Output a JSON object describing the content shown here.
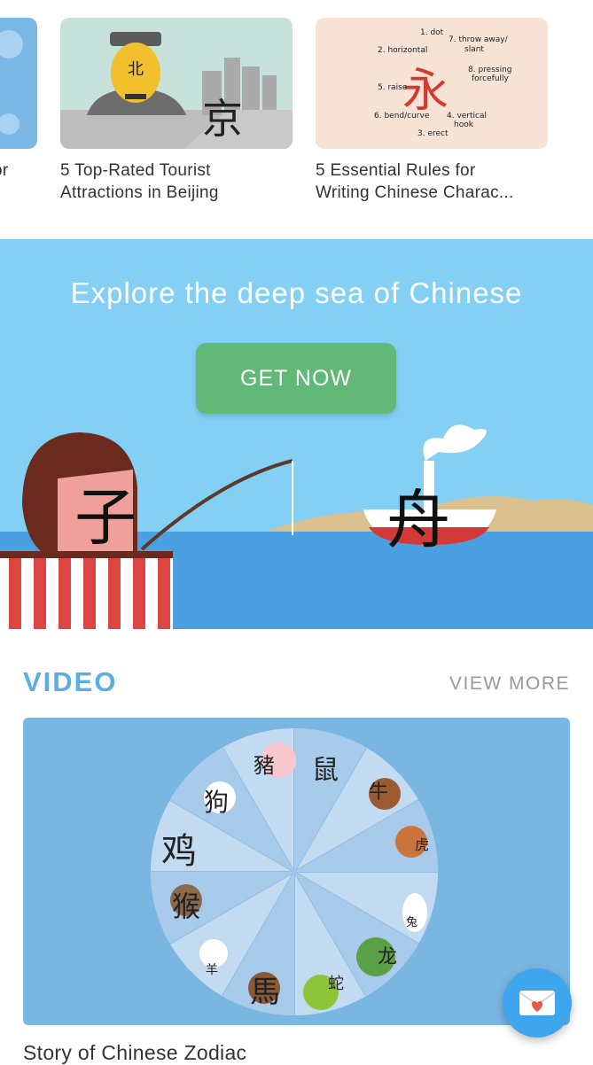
{
  "articles": [
    {
      "title_line1": "",
      "title_line2": "or",
      "image": "partial-blue-thumbnail"
    },
    {
      "title_line1": "5 Top-Rated Tourist",
      "title_line2": "Attractions in Beijing",
      "image": "beijing-figure-thumbnail",
      "char_top": "北",
      "char_main": "京"
    },
    {
      "title_line1": "5 Essential Rules for",
      "title_line2": "Writing Chinese Charac...",
      "image": "stroke-rules-thumbnail",
      "char": "永",
      "strokes": [
        "1. dot",
        "2. horizontal",
        "7. throw away/",
        "slant",
        "8. pressing",
        "forcefully",
        "5. raise",
        "6. bend/curve",
        "4. vertical",
        "hook",
        "3. erect"
      ]
    }
  ],
  "banner": {
    "headline": "Explore the deep sea of Chinese",
    "button_label": "GET NOW",
    "char_boy": "子",
    "char_boat": "舟"
  },
  "video": {
    "section_title": "VIDEO",
    "view_more": "VIEW MORE",
    "caption": "Story of Chinese Zodiac",
    "zodiac": [
      "鼠",
      "牛",
      "虎",
      "兔",
      "龙",
      "蛇",
      "馬",
      "羊",
      "猴",
      "鸡",
      "狗",
      "豬"
    ]
  },
  "fab": {
    "icon": "mail-heart-icon"
  },
  "colors": {
    "accent": "#5aaee0",
    "button": "#61b877",
    "banner_bg": "#84d0f5",
    "sea": "#4aa0e0"
  }
}
